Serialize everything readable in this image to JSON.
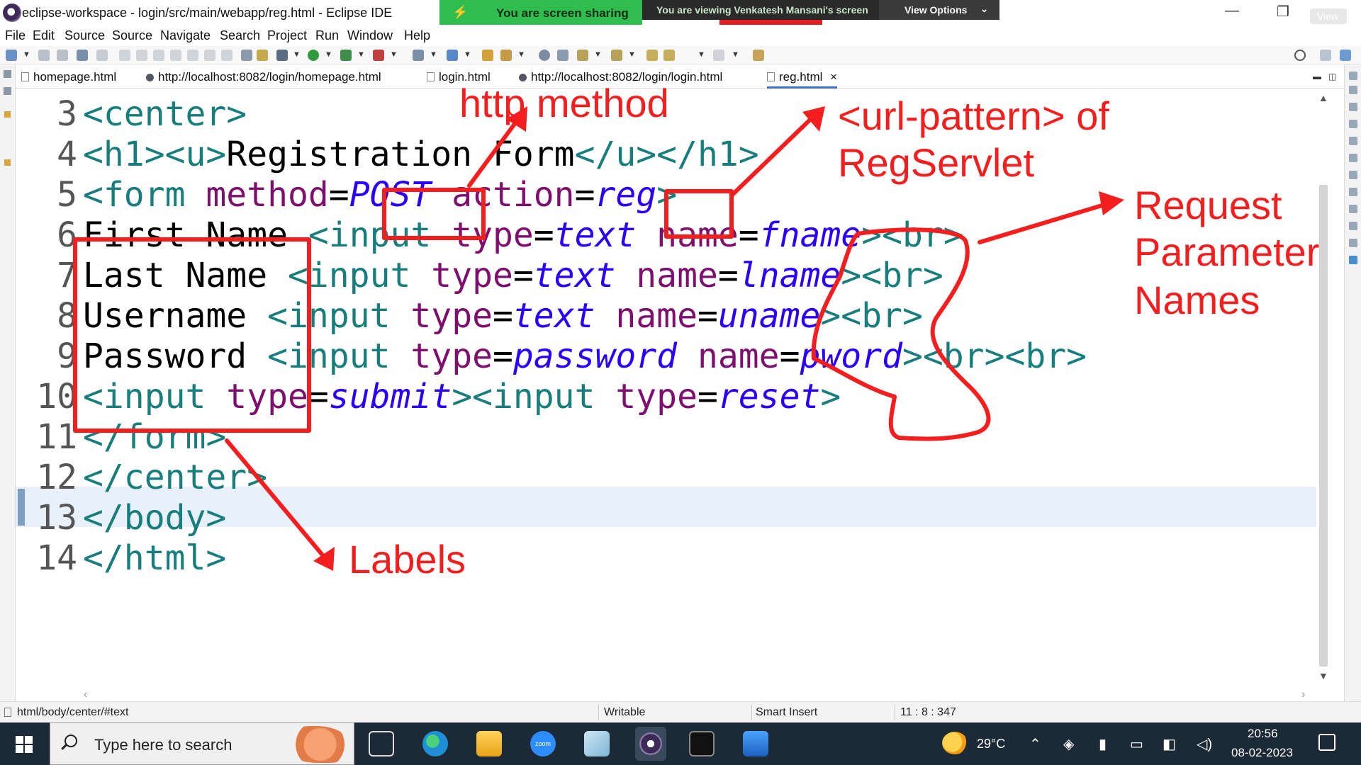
{
  "window": {
    "title": "eclipse-workspace - login/src/main/webapp/reg.html - Eclipse IDE",
    "minimize": "—",
    "restore": "❐",
    "close": "✕",
    "view_badge": "View"
  },
  "screen_share": {
    "status": "You are screen sharing",
    "viewing": "You are viewing Venkatesh Mansani's screen",
    "options": "View Options"
  },
  "menu": [
    "File",
    "Edit",
    "Source",
    "Source",
    "Navigate",
    "Search",
    "Project",
    "Run",
    "Window",
    "Help"
  ],
  "tabs": [
    {
      "label": "homepage.html",
      "icon": "file-icon"
    },
    {
      "label": "http://localhost:8082/login/homepage.html",
      "icon": "globe-icon"
    },
    {
      "label": "login.html",
      "icon": "file-icon"
    },
    {
      "label": "http://localhost:8082/login/login.html",
      "icon": "globe-icon"
    },
    {
      "label": "reg.html",
      "icon": "file-icon",
      "active": true,
      "close": "×"
    }
  ],
  "editor": {
    "lines": [
      {
        "n": "3",
        "code": "<center>"
      },
      {
        "n": "4",
        "code": "<h1><u>Registration Form</u></h1>"
      },
      {
        "n": "5",
        "code": "<form method=POST action=reg>"
      },
      {
        "n": "6",
        "code": "First Name <input type=text name=fname><br>"
      },
      {
        "n": "7",
        "code": "Last Name <input type=text name=lname><br>"
      },
      {
        "n": "8",
        "code": "Username <input type=text name=uname><br>"
      },
      {
        "n": "9",
        "code": "Password <input type=password name=pword><br><br>"
      },
      {
        "n": "10",
        "code": "<input type=submit><input type=reset>"
      },
      {
        "n": "11",
        "code": "</form>"
      },
      {
        "n": "12",
        "code": "</center>"
      },
      {
        "n": "13",
        "code": "</body>"
      },
      {
        "n": "14",
        "code": "</html>"
      }
    ],
    "current_line": 11,
    "colors": {
      "tag": "#177d7d",
      "attribute": "#7f0f6e",
      "value": "#2a00ff",
      "text": "#000000",
      "current_line": "#e8f1fb"
    }
  },
  "annotations": {
    "http_method": "http method",
    "url_pattern_1": "<url-pattern> of",
    "url_pattern_2": "RegServlet",
    "request_params_1": "Request",
    "request_params_2": "Parameter",
    "request_params_3": "Names",
    "labels": "Labels",
    "color": "#f41e1e"
  },
  "status_bar": {
    "path": "html/body/center/#text",
    "mode": "Writable",
    "insert": "Smart Insert",
    "position": "11 : 8 : 347"
  },
  "taskbar": {
    "search_placeholder": "Type here to search",
    "apps": [
      "task-view",
      "edge",
      "file-explorer",
      "zoom",
      "notepad",
      "eclipse",
      "terminal",
      "photos"
    ],
    "zoom_label": "zoom",
    "weather": "29°C",
    "time": "20:56",
    "date": "08-02-2023"
  }
}
